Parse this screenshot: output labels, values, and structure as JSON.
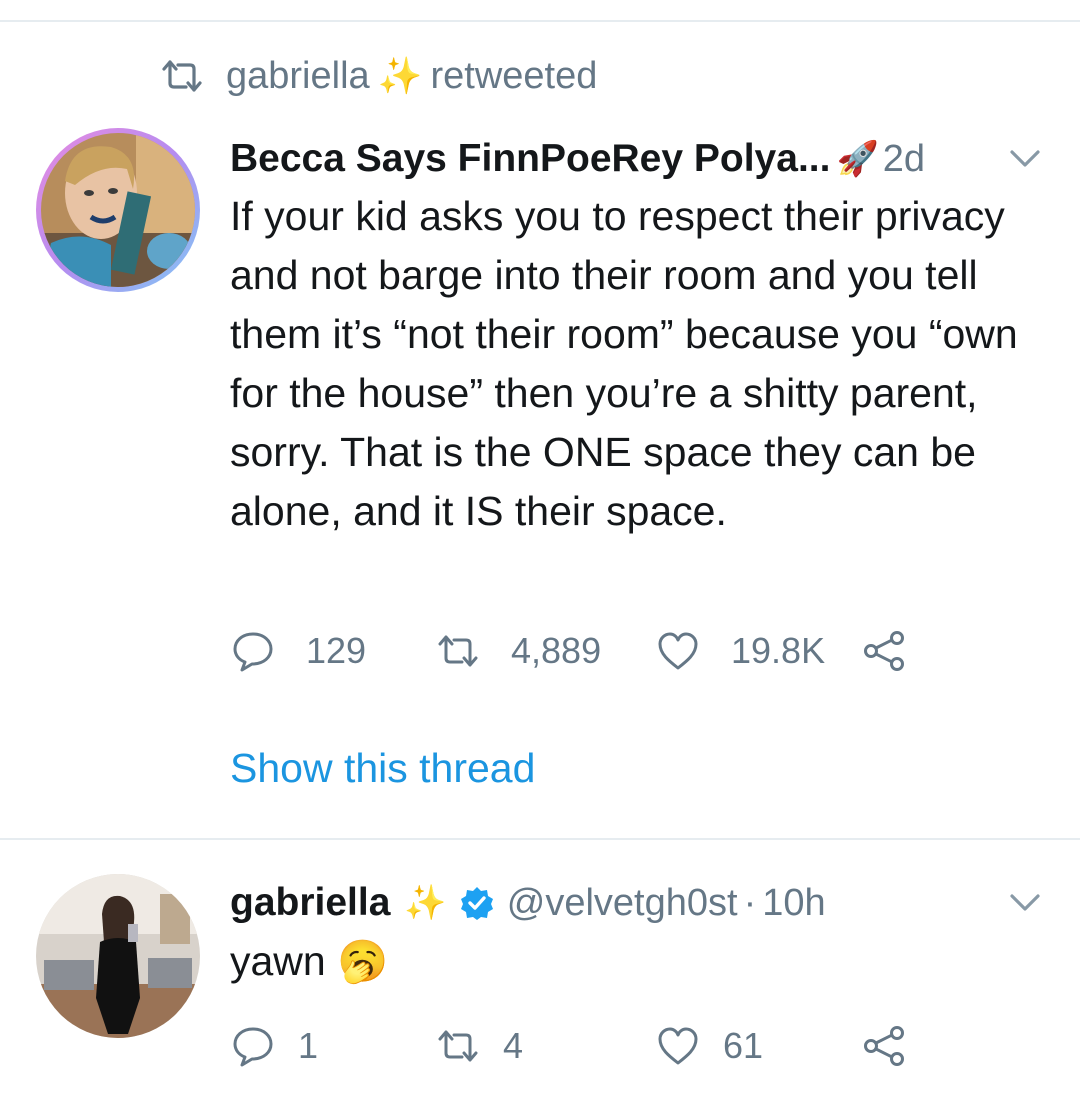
{
  "retweet_header": {
    "name": "gabriella",
    "sparkle": "✨",
    "suffix": "retweeted"
  },
  "tweet1": {
    "display_name": "Becca Says FinnPoeRey Polya...",
    "name_emoji": "🚀",
    "timestamp": "2d",
    "text": "If your kid asks you to respect their privacy and not barge into their room and you tell them it’s “not their room” because you “own for the house” then you’re a shitty parent, sorry. That is the ONE space they can be alone, and it IS their space.",
    "replies": "129",
    "retweets": "4,889",
    "likes": "19.8K",
    "show_thread": "Show this thread"
  },
  "tweet2": {
    "display_name": "gabriella",
    "name_emoji": "✨",
    "handle": "@velvetgh0st",
    "separator": "·",
    "timestamp": "10h",
    "text": "yawn 🥱",
    "replies": "1",
    "retweets": "4",
    "likes": "61"
  },
  "colors": {
    "text": "#14171a",
    "muted": "#657786",
    "link": "#1b95e0",
    "verified": "#1da1f2",
    "divider": "#e6ecf0"
  },
  "icons": [
    "retweet-icon",
    "chevron-down-icon",
    "reply-icon",
    "heart-icon",
    "share-icon",
    "verified-badge-icon"
  ]
}
